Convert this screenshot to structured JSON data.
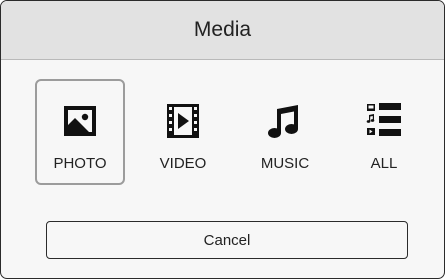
{
  "dialog": {
    "title": "Media",
    "options": [
      {
        "label": "PHOTO",
        "icon": "photo-icon",
        "selected": true
      },
      {
        "label": "VIDEO",
        "icon": "video-icon",
        "selected": false
      },
      {
        "label": "MUSIC",
        "icon": "music-icon",
        "selected": false
      },
      {
        "label": "ALL",
        "icon": "all-media-icon",
        "selected": false
      }
    ],
    "cancel_label": "Cancel"
  },
  "colors": {
    "title_bar": "#e2e2e2",
    "body": "#f7f7f7",
    "border": "#2b2b2b",
    "selection_border": "#9c9c9c",
    "icon": "#111111"
  }
}
